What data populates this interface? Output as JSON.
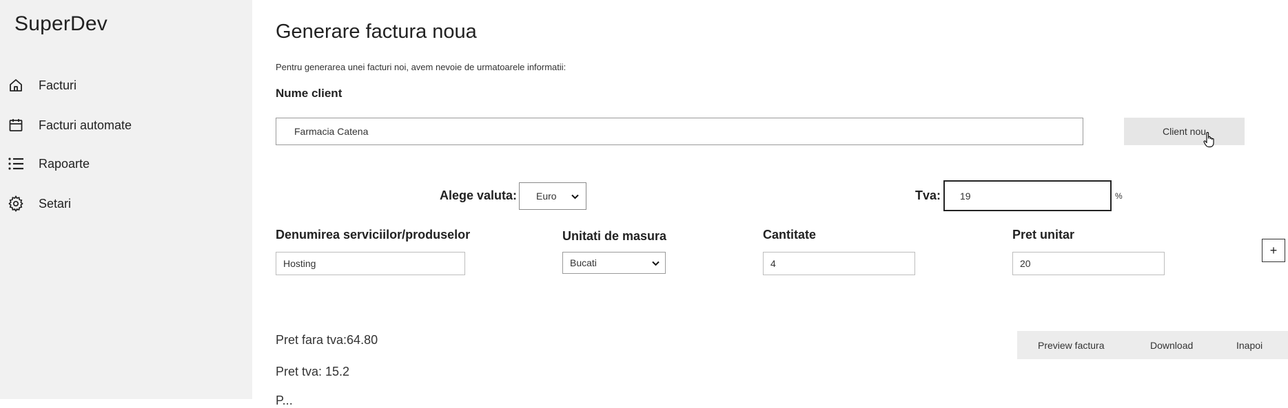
{
  "sidebar": {
    "brand": "SuperDev",
    "items": [
      {
        "label": "Facturi",
        "icon": "home-icon"
      },
      {
        "label": "Facturi automate",
        "icon": "calendar-icon"
      },
      {
        "label": "Rapoarte",
        "icon": "list-icon"
      },
      {
        "label": "Setari",
        "icon": "gear-icon"
      }
    ]
  },
  "main": {
    "title": "Generare factura noua",
    "intro": "Pentru generarea unei facturi noi, avem nevoie de urmatoarele informatii:",
    "client_label": "Nume client",
    "client_value": "Farmacia Catena",
    "client_button": "Client nou",
    "currency_label": "Alege valuta:",
    "currency_value": "Euro",
    "tva_label": "Tva:",
    "tva_value": "19",
    "tva_unit": "%",
    "columns": {
      "service": "Denumirea serviciilor/produselor",
      "unit": "Unitati de masura",
      "quantity": "Cantitate",
      "price": "Pret unitar"
    },
    "row": {
      "service": "Hosting",
      "unit": "Bucati",
      "quantity": "4",
      "price": "20"
    },
    "add_button": "+",
    "totals": {
      "without_tva": "Pret fara tva:64.80",
      "tva": "Pret tva: 15.2",
      "partial": "P..."
    },
    "actions": {
      "preview": "Preview factura",
      "download": "Download",
      "back": "Inapoi"
    }
  }
}
